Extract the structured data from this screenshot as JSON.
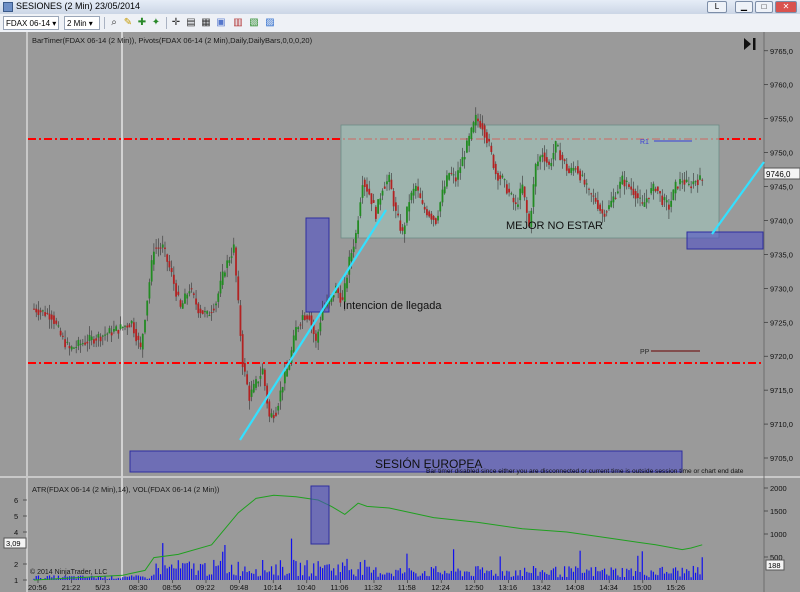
{
  "window": {
    "title": "SESIONES (2 Min)  23/05/2014",
    "lang_button": "L"
  },
  "toolbar": {
    "instrument": "FDAX 06-14",
    "interval": "2 Min"
  },
  "colors": {
    "background": "#9a9a9a",
    "up": "#228b22",
    "down": "#b22222",
    "pivot_line": "#ff0000",
    "trend_line": "#33e0ff",
    "box_fill": "#4a4acc",
    "gray_box": "#9fbcb4",
    "atr_line": "#1fa01f",
    "volume": "#1010ee"
  },
  "main": {
    "indicators_label": "BarTimer(FDAX 06-14 (2 Min)), Pivots(FDAX 06-14 (2 Min),Daily,DailyBars,0,0,0,20)",
    "price_labels": [
      "9765,0",
      "9760,0",
      "9755,0",
      "9750,0",
      "9745,0",
      "9740,0",
      "9735,0",
      "9730,0",
      "9725,0",
      "9720,0",
      "9715,0",
      "9710,0",
      "9705,0"
    ],
    "current_price": "9746,0",
    "annotations": {
      "r1": "R1",
      "pp": "PP",
      "mejor": "MEJOR NO ESTAR",
      "intencion": "Intencion de llegada",
      "sesion": "SESIÓN EUROPEA"
    },
    "bartimer_msg": "Bar timer disabled since either you are disconnected or current time is outside session time or chart end date"
  },
  "lower": {
    "label": "ATR(FDAX 06-14 (2 Min),14), VOL(FDAX 06-14 (2 Min))",
    "left_labels": [
      "6",
      "5",
      "4",
      "2",
      "1"
    ],
    "atr_value": "3,09",
    "right_labels": [
      "2000",
      "1500",
      "1000",
      "500"
    ],
    "vol_value": "188",
    "copyright": "© 2014 NinjaTrader, LLC"
  },
  "time_labels": [
    "20:56",
    "21:22",
    "5/23",
    "08:30",
    "08:56",
    "09:22",
    "09:48",
    "10:14",
    "10:40",
    "11:06",
    "11:32",
    "11:58",
    "12:24",
    "12:50",
    "13:16",
    "13:42",
    "14:08",
    "14:34",
    "15:00",
    "15:26"
  ],
  "chart_data": {
    "type": "candlestick",
    "ylim": [
      9705,
      9766
    ],
    "pivot_levels": {
      "upper": 9752,
      "lower": 9719
    },
    "points": [
      {
        "t": 0,
        "p": 9727
      },
      {
        "t": 8,
        "p": 9726
      },
      {
        "t": 12,
        "p": 9723
      },
      {
        "t": 16,
        "p": 9721
      },
      {
        "t": 22,
        "p": 9722
      },
      {
        "t": 30,
        "p": 9723
      },
      {
        "t": 38,
        "p": 9724
      },
      {
        "t": 44,
        "p": 9725
      },
      {
        "t": 48,
        "p": 9721
      },
      {
        "t": 54,
        "p": 9736
      },
      {
        "t": 58,
        "p": 9736
      },
      {
        "t": 62,
        "p": 9732
      },
      {
        "t": 66,
        "p": 9727
      },
      {
        "t": 70,
        "p": 9730
      },
      {
        "t": 74,
        "p": 9727
      },
      {
        "t": 78,
        "p": 9726
      },
      {
        "t": 82,
        "p": 9728
      },
      {
        "t": 86,
        "p": 9733
      },
      {
        "t": 90,
        "p": 9736
      },
      {
        "t": 94,
        "p": 9719
      },
      {
        "t": 97,
        "p": 9714
      },
      {
        "t": 100,
        "p": 9716
      },
      {
        "t": 103,
        "p": 9718
      },
      {
        "t": 106,
        "p": 9711
      },
      {
        "t": 109,
        "p": 9712
      },
      {
        "t": 112,
        "p": 9716
      },
      {
        "t": 115,
        "p": 9719
      },
      {
        "t": 118,
        "p": 9724
      },
      {
        "t": 121,
        "p": 9726
      },
      {
        "t": 124,
        "p": 9726
      },
      {
        "t": 127,
        "p": 9722
      },
      {
        "t": 130,
        "p": 9727
      },
      {
        "t": 133,
        "p": 9728
      },
      {
        "t": 136,
        "p": 9730
      },
      {
        "t": 139,
        "p": 9728
      },
      {
        "t": 142,
        "p": 9734
      },
      {
        "t": 145,
        "p": 9738
      },
      {
        "t": 148,
        "p": 9746
      },
      {
        "t": 151,
        "p": 9744
      },
      {
        "t": 154,
        "p": 9741
      },
      {
        "t": 157,
        "p": 9745
      },
      {
        "t": 160,
        "p": 9746
      },
      {
        "t": 163,
        "p": 9741
      },
      {
        "t": 166,
        "p": 9738
      },
      {
        "t": 169,
        "p": 9743
      },
      {
        "t": 172,
        "p": 9745
      },
      {
        "t": 175,
        "p": 9742
      },
      {
        "t": 178,
        "p": 9741
      },
      {
        "t": 181,
        "p": 9740
      },
      {
        "t": 184,
        "p": 9744
      },
      {
        "t": 187,
        "p": 9747
      },
      {
        "t": 190,
        "p": 9746
      },
      {
        "t": 193,
        "p": 9749
      },
      {
        "t": 196,
        "p": 9752
      },
      {
        "t": 199,
        "p": 9755
      },
      {
        "t": 202,
        "p": 9754
      },
      {
        "t": 205,
        "p": 9751
      },
      {
        "t": 208,
        "p": 9747
      },
      {
        "t": 211,
        "p": 9746
      },
      {
        "t": 214,
        "p": 9744
      },
      {
        "t": 217,
        "p": 9742
      },
      {
        "t": 220,
        "p": 9745
      },
      {
        "t": 223,
        "p": 9739
      },
      {
        "t": 226,
        "p": 9748
      },
      {
        "t": 229,
        "p": 9750
      },
      {
        "t": 232,
        "p": 9748
      },
      {
        "t": 235,
        "p": 9751
      },
      {
        "t": 238,
        "p": 9749
      },
      {
        "t": 241,
        "p": 9747
      },
      {
        "t": 244,
        "p": 9748
      },
      {
        "t": 247,
        "p": 9746
      },
      {
        "t": 250,
        "p": 9744
      },
      {
        "t": 253,
        "p": 9743
      },
      {
        "t": 256,
        "p": 9741
      },
      {
        "t": 259,
        "p": 9742
      },
      {
        "t": 262,
        "p": 9744
      },
      {
        "t": 265,
        "p": 9746
      },
      {
        "t": 268,
        "p": 9745
      },
      {
        "t": 271,
        "p": 9744
      },
      {
        "t": 274,
        "p": 9742
      },
      {
        "t": 277,
        "p": 9744
      },
      {
        "t": 280,
        "p": 9745
      },
      {
        "t": 283,
        "p": 9743
      },
      {
        "t": 286,
        "p": 9742
      },
      {
        "t": 289,
        "p": 9745
      },
      {
        "t": 292,
        "p": 9746
      },
      {
        "t": 295,
        "p": 9745
      },
      {
        "t": 298,
        "p": 9746
      },
      {
        "t": 301,
        "p": 9746
      }
    ],
    "atr": [
      {
        "t": 0,
        "v": 1.0
      },
      {
        "t": 40,
        "v": 1.3
      },
      {
        "t": 50,
        "v": 1.6
      },
      {
        "t": 54,
        "v": 2.4
      },
      {
        "t": 65,
        "v": 2.6
      },
      {
        "t": 80,
        "v": 3.2
      },
      {
        "t": 92,
        "v": 5.2
      },
      {
        "t": 100,
        "v": 6.1
      },
      {
        "t": 108,
        "v": 6.3
      },
      {
        "t": 118,
        "v": 6.2
      },
      {
        "t": 128,
        "v": 6.0
      },
      {
        "t": 134,
        "v": 5.6
      },
      {
        "t": 140,
        "v": 5.1
      },
      {
        "t": 146,
        "v": 5.8
      },
      {
        "t": 150,
        "v": 5.6
      },
      {
        "t": 160,
        "v": 5.5
      },
      {
        "t": 180,
        "v": 4.9
      },
      {
        "t": 200,
        "v": 4.6
      },
      {
        "t": 220,
        "v": 4.2
      },
      {
        "t": 240,
        "v": 4.0
      },
      {
        "t": 260,
        "v": 3.6
      },
      {
        "t": 280,
        "v": 3.2
      },
      {
        "t": 292,
        "v": 2.9
      },
      {
        "t": 296,
        "v": 3.0
      },
      {
        "t": 301,
        "v": 3.2
      }
    ]
  }
}
